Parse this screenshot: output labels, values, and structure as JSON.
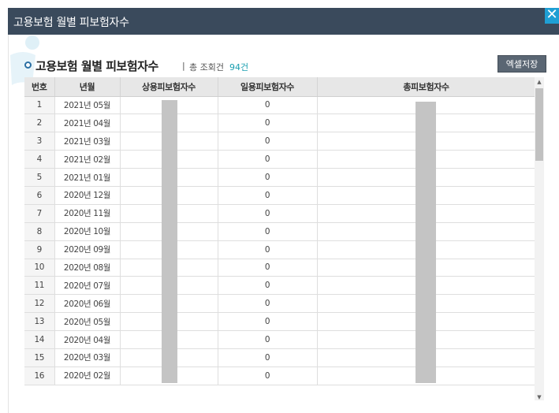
{
  "window": {
    "title": "고용보험 월별 피보험자수",
    "close_label": "✕"
  },
  "panel": {
    "heading": "고용보험 월별 피보험자수",
    "separator": "|",
    "count_label": "총 조회건",
    "count_value": "94건",
    "excel_button": "엑셀저장"
  },
  "table": {
    "columns": [
      "번호",
      "년월",
      "상용피보험자수",
      "일용피보험자수",
      "총피보험자수"
    ],
    "rows": [
      {
        "no": "1",
        "ym": "2021년 05월",
        "daily": "0"
      },
      {
        "no": "2",
        "ym": "2021년 04월",
        "daily": "0"
      },
      {
        "no": "3",
        "ym": "2021년 03월",
        "daily": "0"
      },
      {
        "no": "4",
        "ym": "2021년 02월",
        "daily": "0"
      },
      {
        "no": "5",
        "ym": "2021년 01월",
        "daily": "0"
      },
      {
        "no": "6",
        "ym": "2020년 12월",
        "daily": "0"
      },
      {
        "no": "7",
        "ym": "2020년 11월",
        "daily": "0"
      },
      {
        "no": "8",
        "ym": "2020년 10월",
        "daily": "0"
      },
      {
        "no": "9",
        "ym": "2020년 09월",
        "daily": "0"
      },
      {
        "no": "10",
        "ym": "2020년 08월",
        "daily": "0"
      },
      {
        "no": "11",
        "ym": "2020년 07월",
        "daily": "0"
      },
      {
        "no": "12",
        "ym": "2020년 06월",
        "daily": "0"
      },
      {
        "no": "13",
        "ym": "2020년 05월",
        "daily": "0"
      },
      {
        "no": "14",
        "ym": "2020년 04월",
        "daily": "0"
      },
      {
        "no": "15",
        "ym": "2020년 03월",
        "daily": "0"
      },
      {
        "no": "16",
        "ym": "2020년 02월",
        "daily": "0"
      }
    ]
  },
  "scrollbar": {
    "up_arrow": "▲",
    "down_arrow": "▼"
  }
}
